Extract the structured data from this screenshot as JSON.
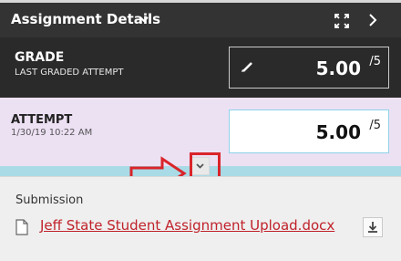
{
  "header": {
    "title": "Assignment Details",
    "icons": [
      "chevron-down-icon",
      "expand-icon",
      "chevron-right-icon"
    ]
  },
  "grade": {
    "label": "GRADE",
    "sublabel": "LAST GRADED ATTEMPT",
    "score": "5.00",
    "out_of": "/5"
  },
  "attempt": {
    "label": "ATTEMPT",
    "timestamp": "1/30/19 10:22 AM",
    "score": "5.00",
    "out_of": "/5"
  },
  "submission": {
    "label": "Submission",
    "file_name": "Jeff State Student Assignment Upload.docx"
  },
  "colors": {
    "header_bg": "#333333",
    "grade_bg": "#2a2a2a",
    "attempt_bg": "#ece0f3",
    "accent_bar": "#a8dbe6",
    "link": "#c0222a",
    "highlight": "#d9252a"
  }
}
